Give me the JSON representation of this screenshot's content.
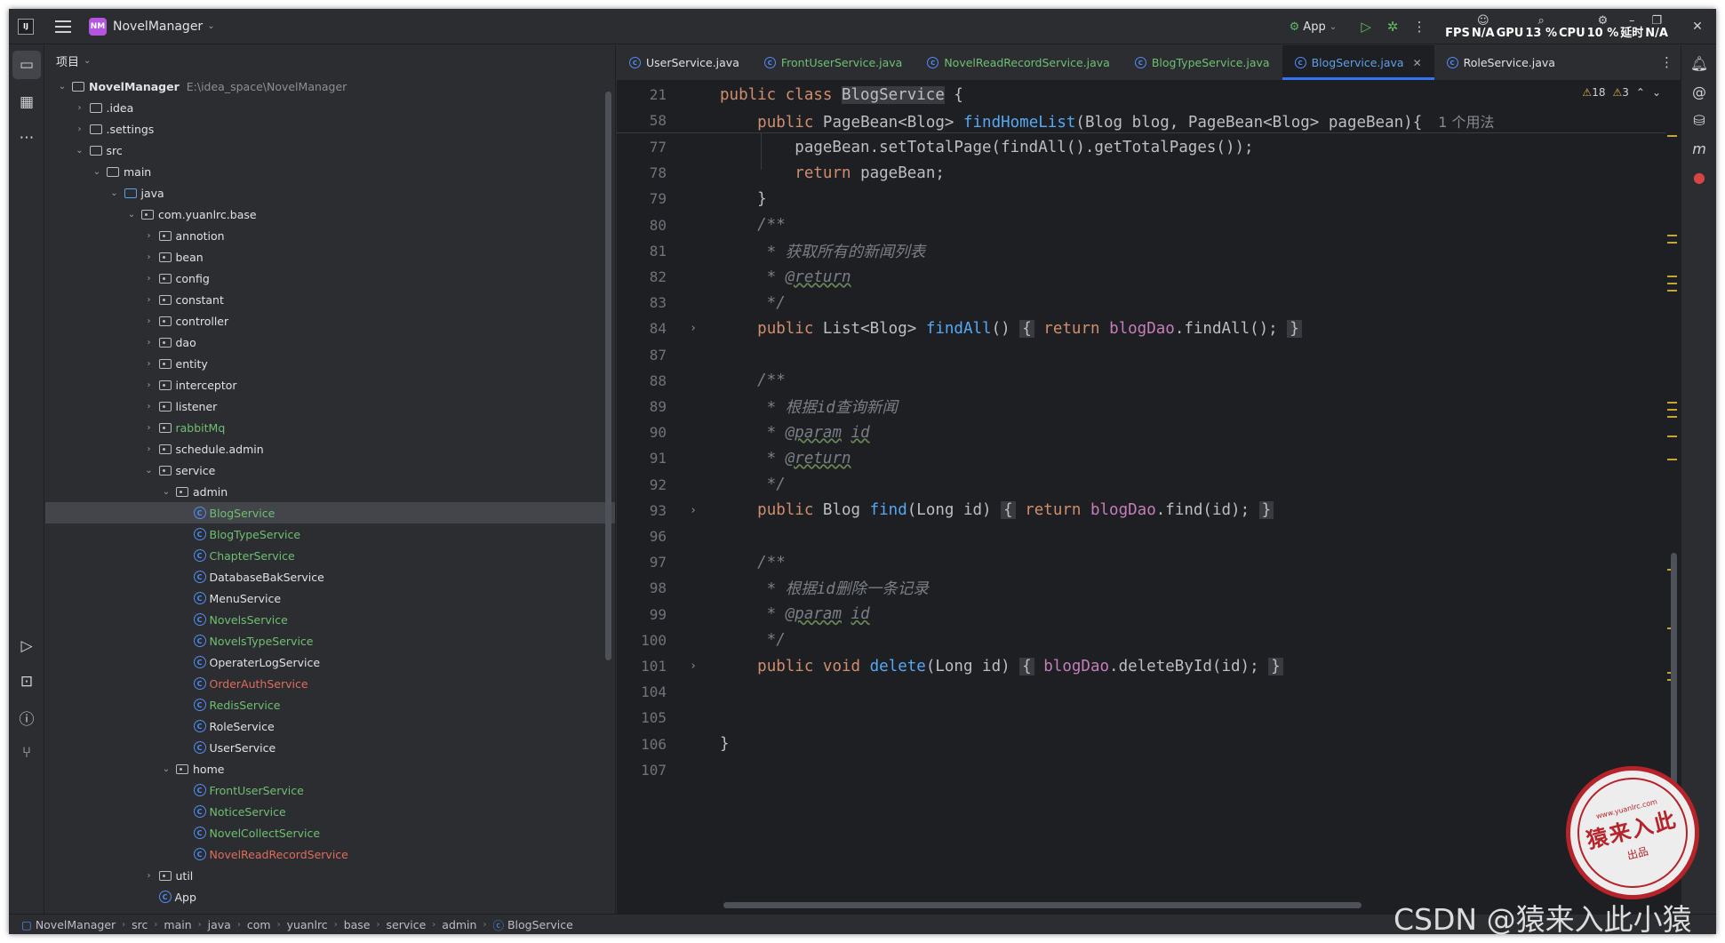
{
  "titlebar": {
    "app_logo": "IJ",
    "project_badge": "NM",
    "project_name": "NovelManager",
    "run_config": "App",
    "stats": [
      {
        "label": "FPS",
        "value": ""
      },
      {
        "label": "N/A",
        "value": ""
      },
      {
        "label": "GPU",
        "value": ""
      },
      {
        "label": "13 %",
        "value": ""
      },
      {
        "label": "CPU",
        "value": ""
      },
      {
        "label": "10 %",
        "value": ""
      },
      {
        "label": "延时",
        "value": ""
      },
      {
        "label": "N/A",
        "value": ""
      }
    ]
  },
  "project_panel": {
    "title": "项目",
    "root_name": "NovelManager",
    "root_path": "E:\\idea_space\\NovelManager",
    "tree": [
      {
        "label": ".idea",
        "depth": 1,
        "kind": "folder",
        "arrow": "›",
        "color": ""
      },
      {
        "label": ".settings",
        "depth": 1,
        "kind": "folder",
        "arrow": "›",
        "color": ""
      },
      {
        "label": "src",
        "depth": 1,
        "kind": "folder",
        "arrow": "⌄",
        "color": ""
      },
      {
        "label": "main",
        "depth": 2,
        "kind": "folder",
        "arrow": "⌄",
        "color": ""
      },
      {
        "label": "java",
        "depth": 3,
        "kind": "folder",
        "arrow": "⌄",
        "color": "blue-folder"
      },
      {
        "label": "com.yuanlrc.base",
        "depth": 4,
        "kind": "package",
        "arrow": "⌄",
        "color": ""
      },
      {
        "label": "annotion",
        "depth": 5,
        "kind": "package",
        "arrow": "›",
        "color": ""
      },
      {
        "label": "bean",
        "depth": 5,
        "kind": "package",
        "arrow": "›",
        "color": ""
      },
      {
        "label": "config",
        "depth": 5,
        "kind": "package",
        "arrow": "›",
        "color": ""
      },
      {
        "label": "constant",
        "depth": 5,
        "kind": "package",
        "arrow": "›",
        "color": ""
      },
      {
        "label": "controller",
        "depth": 5,
        "kind": "package",
        "arrow": "›",
        "color": ""
      },
      {
        "label": "dao",
        "depth": 5,
        "kind": "package",
        "arrow": "›",
        "color": ""
      },
      {
        "label": "entity",
        "depth": 5,
        "kind": "package",
        "arrow": "›",
        "color": ""
      },
      {
        "label": "interceptor",
        "depth": 5,
        "kind": "package",
        "arrow": "›",
        "color": ""
      },
      {
        "label": "listener",
        "depth": 5,
        "kind": "package",
        "arrow": "›",
        "color": ""
      },
      {
        "label": "rabbitMq",
        "depth": 5,
        "kind": "package",
        "arrow": "›",
        "color": "green"
      },
      {
        "label": "schedule.admin",
        "depth": 5,
        "kind": "package",
        "arrow": "›",
        "color": ""
      },
      {
        "label": "service",
        "depth": 5,
        "kind": "package",
        "arrow": "⌄",
        "color": ""
      },
      {
        "label": "admin",
        "depth": 6,
        "kind": "package",
        "arrow": "⌄",
        "color": ""
      },
      {
        "label": "BlogService",
        "depth": 7,
        "kind": "class",
        "arrow": "",
        "color": "green",
        "selected": true
      },
      {
        "label": "BlogTypeService",
        "depth": 7,
        "kind": "class",
        "arrow": "",
        "color": "green"
      },
      {
        "label": "ChapterService",
        "depth": 7,
        "kind": "class",
        "arrow": "",
        "color": "green"
      },
      {
        "label": "DatabaseBakService",
        "depth": 7,
        "kind": "class",
        "arrow": "",
        "color": ""
      },
      {
        "label": "MenuService",
        "depth": 7,
        "kind": "class",
        "arrow": "",
        "color": ""
      },
      {
        "label": "NovelsService",
        "depth": 7,
        "kind": "class",
        "arrow": "",
        "color": "green"
      },
      {
        "label": "NovelsTypeService",
        "depth": 7,
        "kind": "class",
        "arrow": "",
        "color": "green"
      },
      {
        "label": "OperaterLogService",
        "depth": 7,
        "kind": "class",
        "arrow": "",
        "color": ""
      },
      {
        "label": "OrderAuthService",
        "depth": 7,
        "kind": "class",
        "arrow": "",
        "color": "red"
      },
      {
        "label": "RedisService",
        "depth": 7,
        "kind": "class",
        "arrow": "",
        "color": "green"
      },
      {
        "label": "RoleService",
        "depth": 7,
        "kind": "class",
        "arrow": "",
        "color": ""
      },
      {
        "label": "UserService",
        "depth": 7,
        "kind": "class",
        "arrow": "",
        "color": ""
      },
      {
        "label": "home",
        "depth": 6,
        "kind": "package",
        "arrow": "⌄",
        "color": ""
      },
      {
        "label": "FrontUserService",
        "depth": 7,
        "kind": "class",
        "arrow": "",
        "color": "green"
      },
      {
        "label": "NoticeService",
        "depth": 7,
        "kind": "class",
        "arrow": "",
        "color": "green"
      },
      {
        "label": "NovelCollectService",
        "depth": 7,
        "kind": "class",
        "arrow": "",
        "color": "green"
      },
      {
        "label": "NovelReadRecordService",
        "depth": 7,
        "kind": "class",
        "arrow": "",
        "color": "red"
      },
      {
        "label": "util",
        "depth": 5,
        "kind": "package",
        "arrow": "›",
        "color": ""
      },
      {
        "label": "App",
        "depth": 5,
        "kind": "class",
        "arrow": "",
        "color": ""
      }
    ]
  },
  "tabs": [
    {
      "label": "UserService.java",
      "color": "",
      "active": false
    },
    {
      "label": "FrontUserService.java",
      "color": "green",
      "active": false
    },
    {
      "label": "NovelReadRecordService.java",
      "color": "green",
      "active": false
    },
    {
      "label": "BlogTypeService.java",
      "color": "green",
      "active": false
    },
    {
      "label": "BlogService.java",
      "color": "green",
      "active": true
    },
    {
      "label": "RoleService.java",
      "color": "",
      "active": false
    }
  ],
  "inspection": {
    "warnings": "18",
    "weak_warnings": "3"
  },
  "editor": {
    "sticky_lines": [
      {
        "n": "21",
        "segments": [
          [
            "kw",
            "public class "
          ],
          [
            "hl",
            "BlogService"
          ],
          [
            "",
            " {"
          ]
        ]
      },
      {
        "n": "58",
        "segments": [
          [
            "",
            "    "
          ],
          [
            "kw",
            "public "
          ],
          [
            "",
            "PageBean<Blog> "
          ],
          [
            "fn",
            "findHomeList"
          ],
          [
            "",
            "(Blog blog, PageBean<Blog> pageBean){"
          ]
        ],
        "usage": "1 个用法"
      }
    ],
    "lines": [
      {
        "n": "77",
        "segments": [
          [
            "",
            "        pageBean.setTotalPage(findAll().getTotalPages());"
          ]
        ]
      },
      {
        "n": "78",
        "segments": [
          [
            "",
            "        "
          ],
          [
            "kw",
            "return "
          ],
          [
            "",
            "pageBean;"
          ]
        ]
      },
      {
        "n": "79",
        "segments": [
          [
            "",
            "    }"
          ]
        ]
      },
      {
        "n": "80",
        "segments": [
          [
            "cm",
            "    /**"
          ]
        ]
      },
      {
        "n": "81",
        "segments": [
          [
            "cm",
            "     * 获取所有的新闻列表"
          ]
        ]
      },
      {
        "n": "82",
        "segments": [
          [
            "cm",
            "     * "
          ],
          [
            "cmtag",
            "@return"
          ]
        ]
      },
      {
        "n": "83",
        "segments": [
          [
            "cm",
            "     */"
          ]
        ]
      },
      {
        "n": "84",
        "fold": "›",
        "segments": [
          [
            "",
            "    "
          ],
          [
            "kw",
            "public "
          ],
          [
            "",
            "List<Blog> "
          ],
          [
            "fn",
            "findAll"
          ],
          [
            "",
            "() "
          ],
          [
            "fbox",
            "{"
          ],
          [
            "",
            " "
          ],
          [
            "kw",
            "return "
          ],
          [
            "fld",
            "blogDao"
          ],
          [
            "",
            ".findAll(); "
          ],
          [
            "fbox",
            "}"
          ]
        ]
      },
      {
        "n": "87",
        "segments": [
          [
            "",
            ""
          ]
        ]
      },
      {
        "n": "88",
        "segments": [
          [
            "cm",
            "    /**"
          ]
        ]
      },
      {
        "n": "89",
        "segments": [
          [
            "cm",
            "     * 根据id查询新闻"
          ]
        ]
      },
      {
        "n": "90",
        "segments": [
          [
            "cm",
            "     * "
          ],
          [
            "cmtag",
            "@param"
          ],
          [
            "cm",
            " "
          ],
          [
            "cmtag",
            "id"
          ]
        ]
      },
      {
        "n": "91",
        "segments": [
          [
            "cm",
            "     * "
          ],
          [
            "cmtag",
            "@return"
          ]
        ]
      },
      {
        "n": "92",
        "segments": [
          [
            "cm",
            "     */"
          ]
        ]
      },
      {
        "n": "93",
        "fold": "›",
        "segments": [
          [
            "",
            "    "
          ],
          [
            "kw",
            "public "
          ],
          [
            "",
            "Blog "
          ],
          [
            "fn",
            "find"
          ],
          [
            "",
            "(Long id) "
          ],
          [
            "fbox",
            "{"
          ],
          [
            "",
            " "
          ],
          [
            "kw",
            "return "
          ],
          [
            "fld",
            "blogDao"
          ],
          [
            "",
            ".find(id); "
          ],
          [
            "fbox",
            "}"
          ]
        ]
      },
      {
        "n": "96",
        "segments": [
          [
            "",
            ""
          ]
        ]
      },
      {
        "n": "97",
        "segments": [
          [
            "cm",
            "    /**"
          ]
        ]
      },
      {
        "n": "98",
        "segments": [
          [
            "cm",
            "     * 根据id删除一条记录"
          ]
        ]
      },
      {
        "n": "99",
        "segments": [
          [
            "cm",
            "     * "
          ],
          [
            "cmtag",
            "@param"
          ],
          [
            "cm",
            " "
          ],
          [
            "cmtag",
            "id"
          ]
        ]
      },
      {
        "n": "100",
        "segments": [
          [
            "cm",
            "     */"
          ]
        ]
      },
      {
        "n": "101",
        "fold": "›",
        "segments": [
          [
            "",
            "    "
          ],
          [
            "kw",
            "public void "
          ],
          [
            "fn",
            "delete"
          ],
          [
            "",
            "(Long id) "
          ],
          [
            "fbox",
            "{"
          ],
          [
            "",
            " "
          ],
          [
            "fld",
            "blogDao"
          ],
          [
            "",
            ".deleteById(id); "
          ],
          [
            "fbox",
            "}"
          ]
        ]
      },
      {
        "n": "104",
        "segments": [
          [
            "",
            ""
          ]
        ]
      },
      {
        "n": "105",
        "segments": [
          [
            "",
            ""
          ]
        ]
      },
      {
        "n": "106",
        "segments": [
          [
            "",
            "}"
          ]
        ]
      },
      {
        "n": "107",
        "segments": [
          [
            "",
            ""
          ]
        ]
      }
    ]
  },
  "statusbar": {
    "breadcrumb": [
      "NovelManager",
      "src",
      "main",
      "java",
      "com",
      "yuanlrc",
      "base",
      "service",
      "admin",
      "BlogService"
    ]
  },
  "watermark": {
    "seal_url": "www.yuanlrc.com",
    "seal_main": "猿来入此",
    "seal_sub": "出品",
    "csdn": "CSDN @猿来入此小猿"
  },
  "colors": {
    "accent": "#3574f0",
    "keyword": "#cf8e6d",
    "function": "#56a8f5",
    "field": "#c77dbb",
    "comment": "#7a7e85",
    "vcs_added": "#6fbf73",
    "vcs_conflict": "#e06c5b"
  }
}
